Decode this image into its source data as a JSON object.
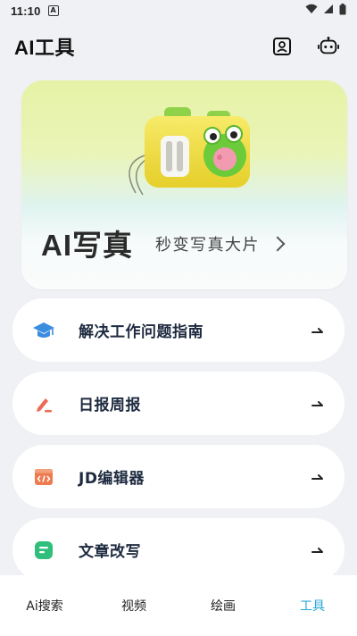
{
  "status_bar": {
    "time": "11:10",
    "notification_badge": "A"
  },
  "header": {
    "title": "AI工具",
    "icons": [
      "contact-card-icon",
      "robot-icon"
    ]
  },
  "banner": {
    "title": "AI写真",
    "subtitle": "秒变写真大片"
  },
  "tools": [
    {
      "label": "解决工作问题指南",
      "icon": "graduation-cap-icon",
      "color": "#3b8de0"
    },
    {
      "label": "日报周报",
      "icon": "pen-edit-icon",
      "color": "#ec6a57"
    },
    {
      "label": "JD编辑器",
      "icon": "code-window-icon",
      "color": "#ee7b4f"
    },
    {
      "label": "文章改写",
      "icon": "document-icon",
      "color": "#2fbf7a"
    }
  ],
  "bottom_nav": {
    "items": [
      "Ai搜索",
      "视频",
      "绘画",
      "工具"
    ],
    "active_index": 3,
    "active_color": "#29a9d9"
  }
}
